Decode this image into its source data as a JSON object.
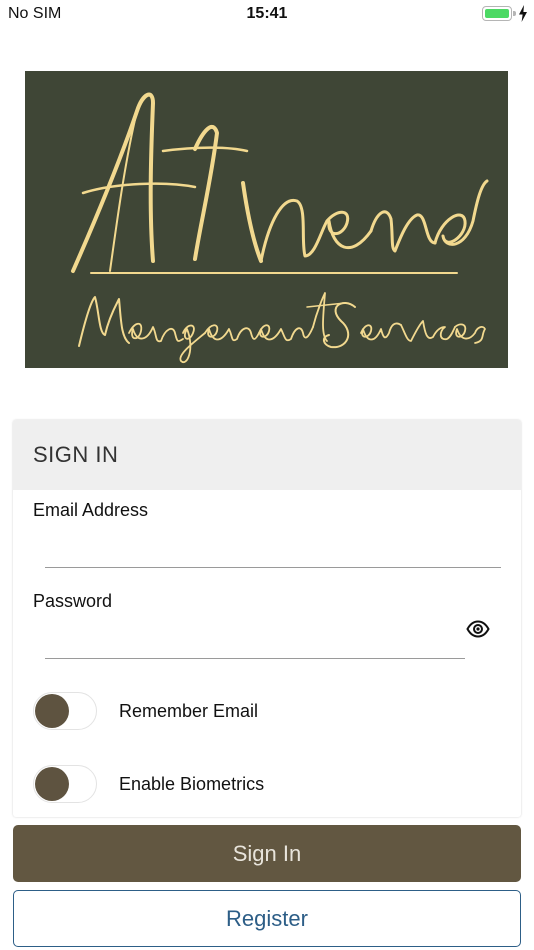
{
  "status_bar": {
    "carrier": "No SIM",
    "time": "15:41",
    "battery_level": 1.0,
    "charging": true
  },
  "logo": {
    "title": "Athena",
    "subtitle": "Management Services",
    "background_color": "#3f4636",
    "text_color": "#f2d98f"
  },
  "sign_in_card": {
    "header": "SIGN IN",
    "email": {
      "label": "Email Address",
      "value": "",
      "placeholder": ""
    },
    "password": {
      "label": "Password",
      "value": "",
      "placeholder": "",
      "toggle_icon": "eye-icon"
    },
    "remember_email": {
      "label": "Remember Email",
      "checked": false
    },
    "enable_biometrics": {
      "label": "Enable Biometrics",
      "checked": false
    }
  },
  "buttons": {
    "sign_in": "Sign In",
    "register": "Register"
  },
  "colors": {
    "primary": "#625741",
    "link": "#2d5e87",
    "header_bg": "#efefef",
    "battery": "#4cd964"
  }
}
